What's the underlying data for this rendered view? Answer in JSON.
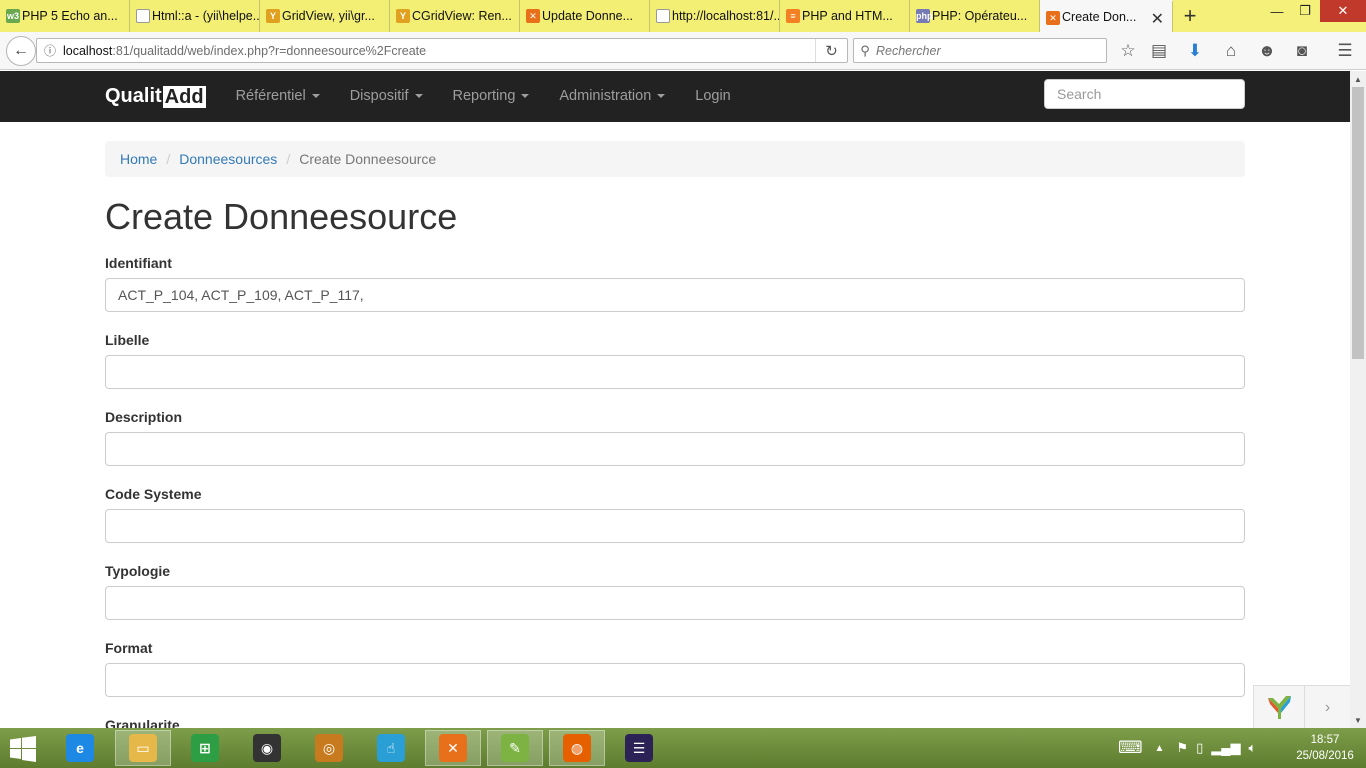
{
  "browser": {
    "tabs": [
      {
        "label": "PHP 5 Echo an...",
        "icon": "w3schools-icon",
        "color": "#6aa84f",
        "glyph": "w3"
      },
      {
        "label": "Html::a - (yii\\helpe...",
        "icon": "blank-page-icon",
        "color": "#ffffff",
        "glyph": ""
      },
      {
        "label": "GridView, yii\\gr...",
        "icon": "yii-icon",
        "color": "#e0a020",
        "glyph": "Y"
      },
      {
        "label": "CGridView: Ren...",
        "icon": "yii-icon",
        "color": "#e0a020",
        "glyph": "Y"
      },
      {
        "label": "Update Donne...",
        "icon": "xampp-icon",
        "color": "#e8701a",
        "glyph": "✕"
      },
      {
        "label": "http://localhost:81/...",
        "icon": "blank-page-icon",
        "color": "#ffffff",
        "glyph": ""
      },
      {
        "label": "PHP and HTM...",
        "icon": "stackoverflow-icon",
        "color": "#f48024",
        "glyph": "≡"
      },
      {
        "label": "PHP: Opérateu...",
        "icon": "php-icon",
        "color": "#777bb3",
        "glyph": "php"
      }
    ],
    "active_tab": {
      "label": "Create Don...",
      "icon": "xampp-icon",
      "color": "#e8701a",
      "glyph": "✕"
    },
    "url_host": "localhost",
    "url_path": ":81/qualitadd/web/index.php?r=donneesource%2Fcreate",
    "search_placeholder": "Rechercher"
  },
  "app": {
    "brand_prefix": "Qualit",
    "brand_boxed": "Add",
    "menu": [
      {
        "label": "Référentiel",
        "dropdown": true
      },
      {
        "label": "Dispositif",
        "dropdown": true
      },
      {
        "label": "Reporting",
        "dropdown": true
      },
      {
        "label": "Administration",
        "dropdown": true
      },
      {
        "label": "Login",
        "dropdown": false
      }
    ],
    "search_placeholder": "Search"
  },
  "breadcrumb": {
    "home": "Home",
    "section": "Donneesources",
    "current": "Create Donneesource"
  },
  "page_title": "Create Donneesource",
  "form": {
    "fields": [
      {
        "label": "Identifiant",
        "value": "ACT_P_104, ACT_P_109, ACT_P_117,"
      },
      {
        "label": "Libelle",
        "value": ""
      },
      {
        "label": "Description",
        "value": ""
      },
      {
        "label": "Code Systeme",
        "value": ""
      },
      {
        "label": "Typologie",
        "value": ""
      },
      {
        "label": "Format",
        "value": ""
      },
      {
        "label": "Granularite",
        "value": ""
      }
    ]
  },
  "taskbar": {
    "time": "18:57",
    "date": "25/08/2016",
    "apps": [
      {
        "name": "internet-explorer-icon",
        "color": "#1e88e5",
        "glyph": "e"
      },
      {
        "name": "file-explorer-icon",
        "color": "#e6b84a",
        "glyph": "▭"
      },
      {
        "name": "store-icon",
        "color": "#2e9e44",
        "glyph": "⊞"
      },
      {
        "name": "speaker-app-icon",
        "color": "#333333",
        "glyph": "◉"
      },
      {
        "name": "media-app-icon",
        "color": "#c77b1e",
        "glyph": "◎"
      },
      {
        "name": "touch-app-icon",
        "color": "#2a9fd6",
        "glyph": "☝"
      },
      {
        "name": "xampp-icon",
        "color": "#e8701a",
        "glyph": "✕"
      },
      {
        "name": "notepad-plus-icon",
        "color": "#7cb342",
        "glyph": "✎"
      },
      {
        "name": "firefox-icon",
        "color": "#e66000",
        "glyph": "◍"
      },
      {
        "name": "eclipse-icon",
        "color": "#2c2255",
        "glyph": "☰"
      }
    ]
  }
}
